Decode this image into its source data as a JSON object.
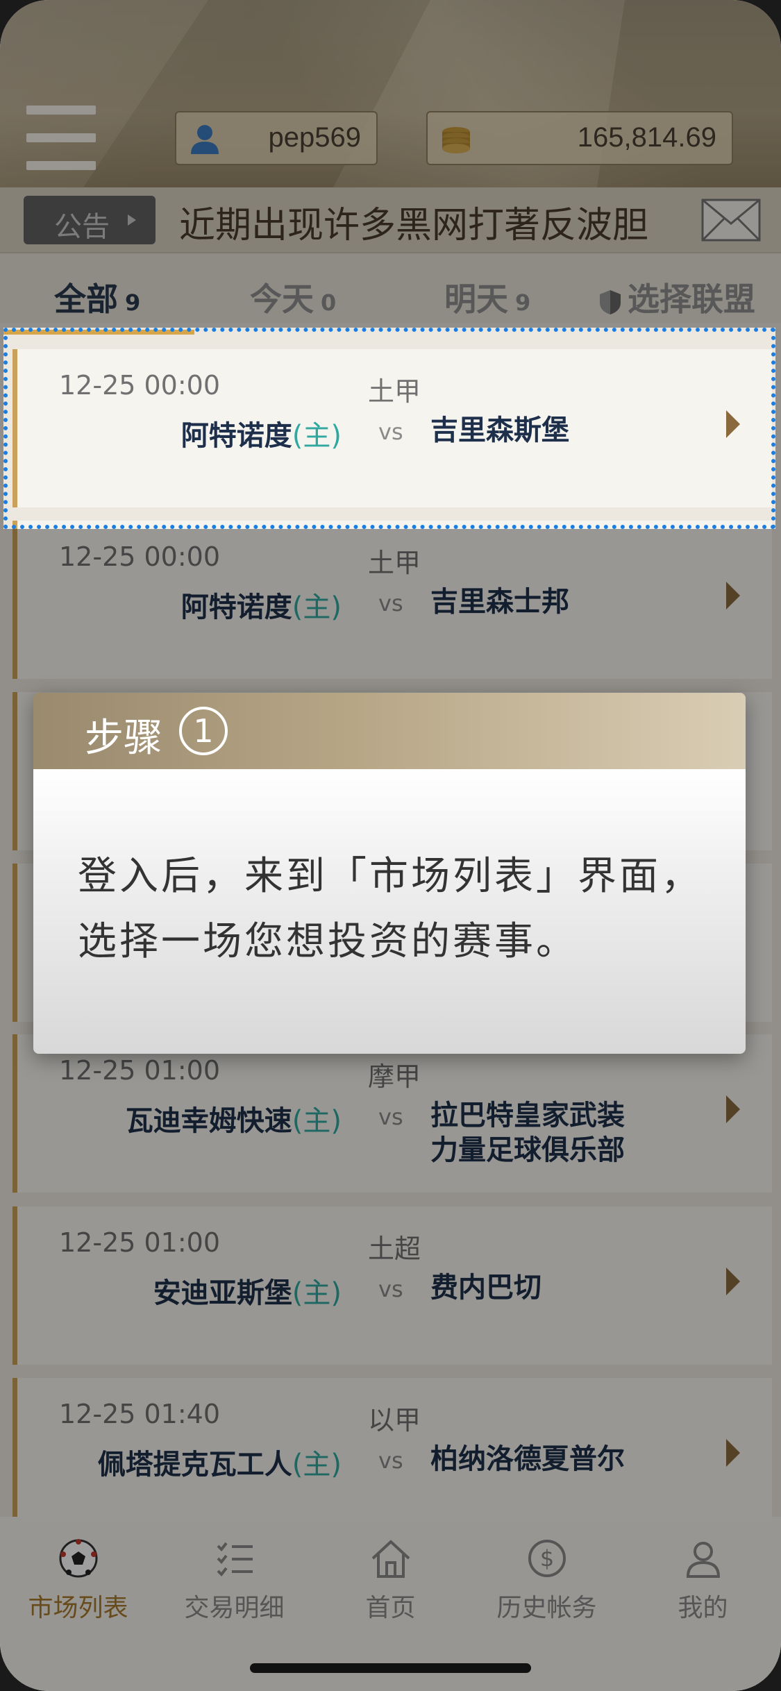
{
  "header": {
    "username": "pep569",
    "balance": "165,814.69",
    "icons": [
      "menu-icon",
      "user-icon",
      "coins-icon"
    ]
  },
  "notice": {
    "tag": "公告",
    "text": "近期出现许多黑网打著反波胆",
    "icon": "mail-icon"
  },
  "tabs": {
    "all": {
      "label": "全部",
      "count": "9"
    },
    "today": {
      "label": "今天",
      "count": "0"
    },
    "tomorrow": {
      "label": "明天",
      "count": "9"
    },
    "league": {
      "label": "选择联盟"
    }
  },
  "home_tag": "(主)",
  "vs": "vs",
  "matches": [
    {
      "time": "12-25 00:00",
      "league": "土甲",
      "home": "阿特诺度",
      "away": "吉里森斯堡"
    },
    {
      "time": "12-25 00:00",
      "league": "土甲",
      "home": "阿特诺度",
      "away": "吉里森士邦"
    },
    {
      "time": "12-25 01:00",
      "league": "摩甲",
      "home": "瓦迪幸姆快速",
      "away_line1": "拉巴特皇家武装",
      "away_line2": "力量足球俱乐部"
    },
    {
      "time": "12-25 01:00",
      "league": "土超",
      "home": "安迪亚斯堡",
      "away": "费内巴切"
    },
    {
      "time": "12-25 01:40",
      "league": "以甲",
      "home": "佩塔提克瓦工人",
      "away": "柏纳洛德夏普尔"
    }
  ],
  "step": {
    "title": "步骤",
    "number": "1",
    "line1": "登入后，来到「市场列表」界面，",
    "line2": "选择一场您想投资的赛事。"
  },
  "nav": [
    {
      "label": "市场列表",
      "icon": "soccer-ball-icon"
    },
    {
      "label": "交易明细",
      "icon": "checklist-icon"
    },
    {
      "label": "首页",
      "icon": "home-icon"
    },
    {
      "label": "历史帐务",
      "icon": "dollar-icon"
    },
    {
      "label": "我的",
      "icon": "profile-icon"
    }
  ]
}
